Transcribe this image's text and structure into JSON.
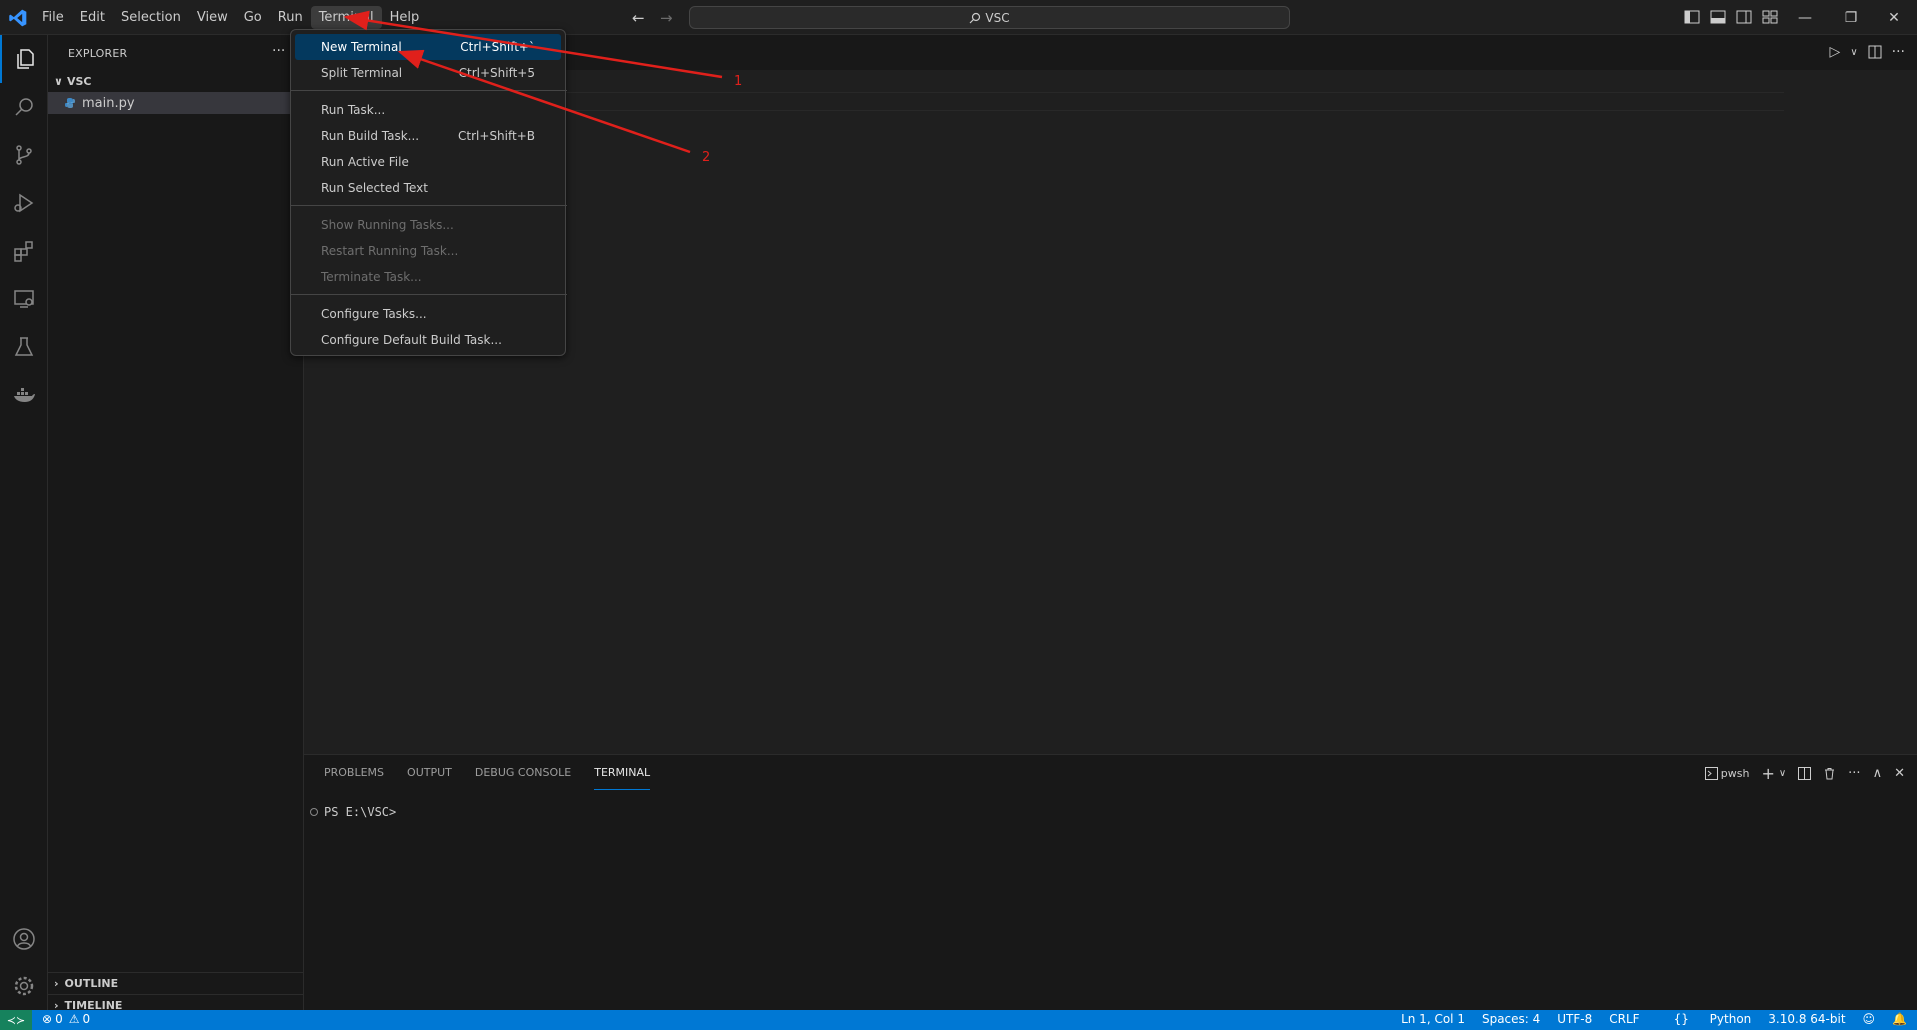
{
  "menubar": {
    "items": [
      "File",
      "Edit",
      "Selection",
      "View",
      "Go",
      "Run",
      "Terminal",
      "Help"
    ]
  },
  "command_center": {
    "text": "VSC"
  },
  "sidebar": {
    "title": "EXPLORER",
    "more": "···",
    "folder": "VSC",
    "file": "main.py",
    "outline": "OUTLINE",
    "timeline": "TIMELINE"
  },
  "terminal_menu": {
    "new_terminal": "New Terminal",
    "new_terminal_shortcut": "Ctrl+Shift+`",
    "split_terminal": "Split Terminal",
    "split_terminal_shortcut": "Ctrl+Shift+5",
    "run_task": "Run Task...",
    "run_build_task": "Run Build Task...",
    "run_build_task_shortcut": "Ctrl+Shift+B",
    "run_active_file": "Run Active File",
    "run_selected_text": "Run Selected Text",
    "show_running_tasks": "Show Running Tasks...",
    "restart_running_task": "Restart Running Task...",
    "terminate_task": "Terminate Task...",
    "configure_tasks": "Configure Tasks...",
    "configure_default_build_task": "Configure Default Build Task..."
  },
  "panel": {
    "tabs": [
      "PROBLEMS",
      "OUTPUT",
      "DEBUG CONSOLE",
      "TERMINAL"
    ],
    "active_tab": "TERMINAL",
    "shell": "pwsh",
    "prompt": "PS E:\\VSC>"
  },
  "statusbar": {
    "errors": "0",
    "warnings": "0",
    "position": "Ln 1, Col 1",
    "spaces": "Spaces: 4",
    "encoding": "UTF-8",
    "eol": "CRLF",
    "language": "Python",
    "interpreter": "3.10.8 64-bit"
  },
  "annotations": {
    "label_1": "1",
    "label_2": "2",
    "arrow_color": "#e0201b"
  },
  "colors": {
    "accent": "#0078d4",
    "statusbar_bg": "#0078d4",
    "remote_bg": "#16825d",
    "menu_highlight": "#04395e"
  }
}
